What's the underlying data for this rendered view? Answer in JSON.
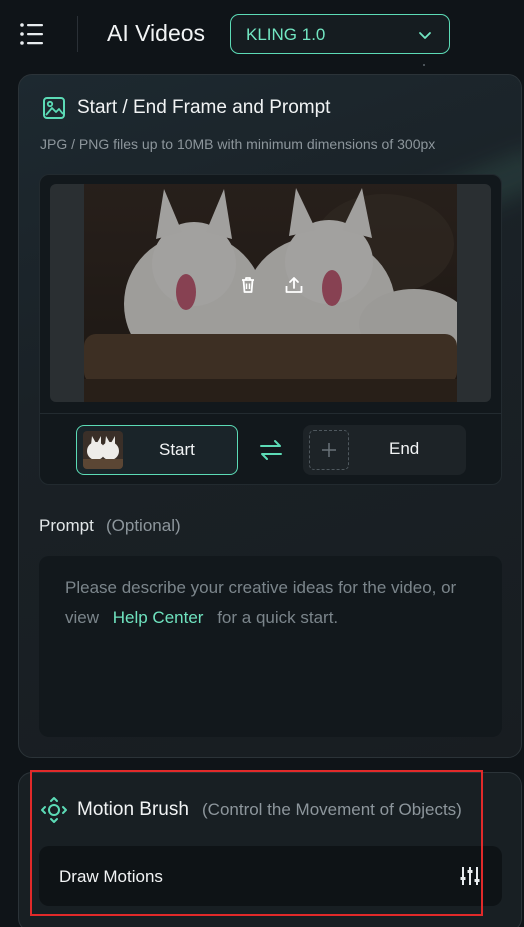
{
  "header": {
    "title": "AI Videos",
    "model_select": {
      "value": "KLING 1.0"
    }
  },
  "frame_section": {
    "title": "Start / End Frame and Prompt",
    "subtitle": "JPG / PNG files up to 10MB with minimum dimensions of 300px",
    "start_label": "Start",
    "end_label": "End"
  },
  "prompt": {
    "title": "Prompt",
    "optional": "(Optional)",
    "placeholder_line1": "Please describe your creative ideas for the video, or",
    "placeholder_pre": "view",
    "help_link": "Help Center",
    "placeholder_post": "for a quick start."
  },
  "motion_brush": {
    "title": "Motion Brush",
    "subtitle": "(Control the Movement of Objects)",
    "draw_label": "Draw Motions"
  },
  "icons": {
    "menu": "menu-icon",
    "chevron": "chevron-down-icon",
    "image": "image-icon",
    "trash": "trash-icon",
    "upload": "upload-icon",
    "swap": "swap-icon",
    "plus": "plus-icon",
    "motion": "motion-brush-icon",
    "sliders": "sliders-icon"
  },
  "colors": {
    "accent": "#5cdbb6",
    "background": "#0f1418",
    "highlight": "#e12a2a"
  }
}
